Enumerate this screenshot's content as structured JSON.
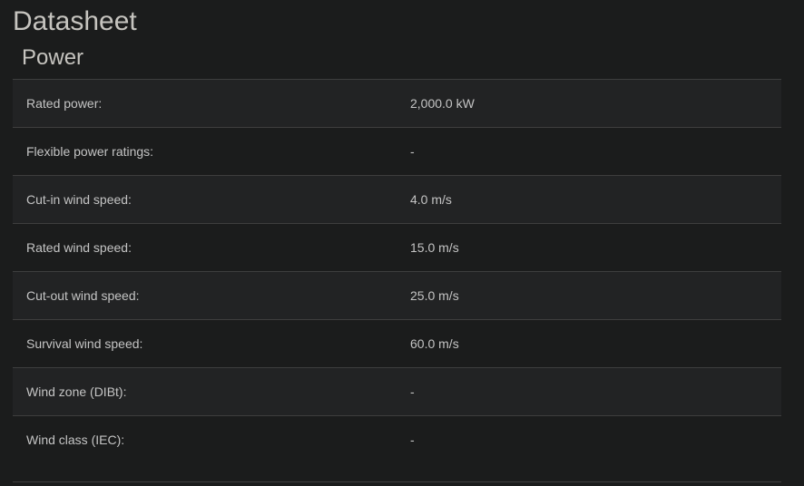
{
  "page_title": "Datasheet",
  "section_title": "Power",
  "rows": [
    {
      "label": "Rated power:",
      "value": "2,000.0 kW"
    },
    {
      "label": "Flexible power ratings:",
      "value": "-"
    },
    {
      "label": "Cut-in wind speed:",
      "value": "4.0 m/s"
    },
    {
      "label": "Rated wind speed:",
      "value": "15.0 m/s"
    },
    {
      "label": "Cut-out wind speed:",
      "value": "25.0 m/s"
    },
    {
      "label": "Survival wind speed:",
      "value": "60.0 m/s"
    },
    {
      "label": "Wind zone (DIBt):",
      "value": "-"
    },
    {
      "label": "Wind class (IEC):",
      "value": "-"
    }
  ]
}
